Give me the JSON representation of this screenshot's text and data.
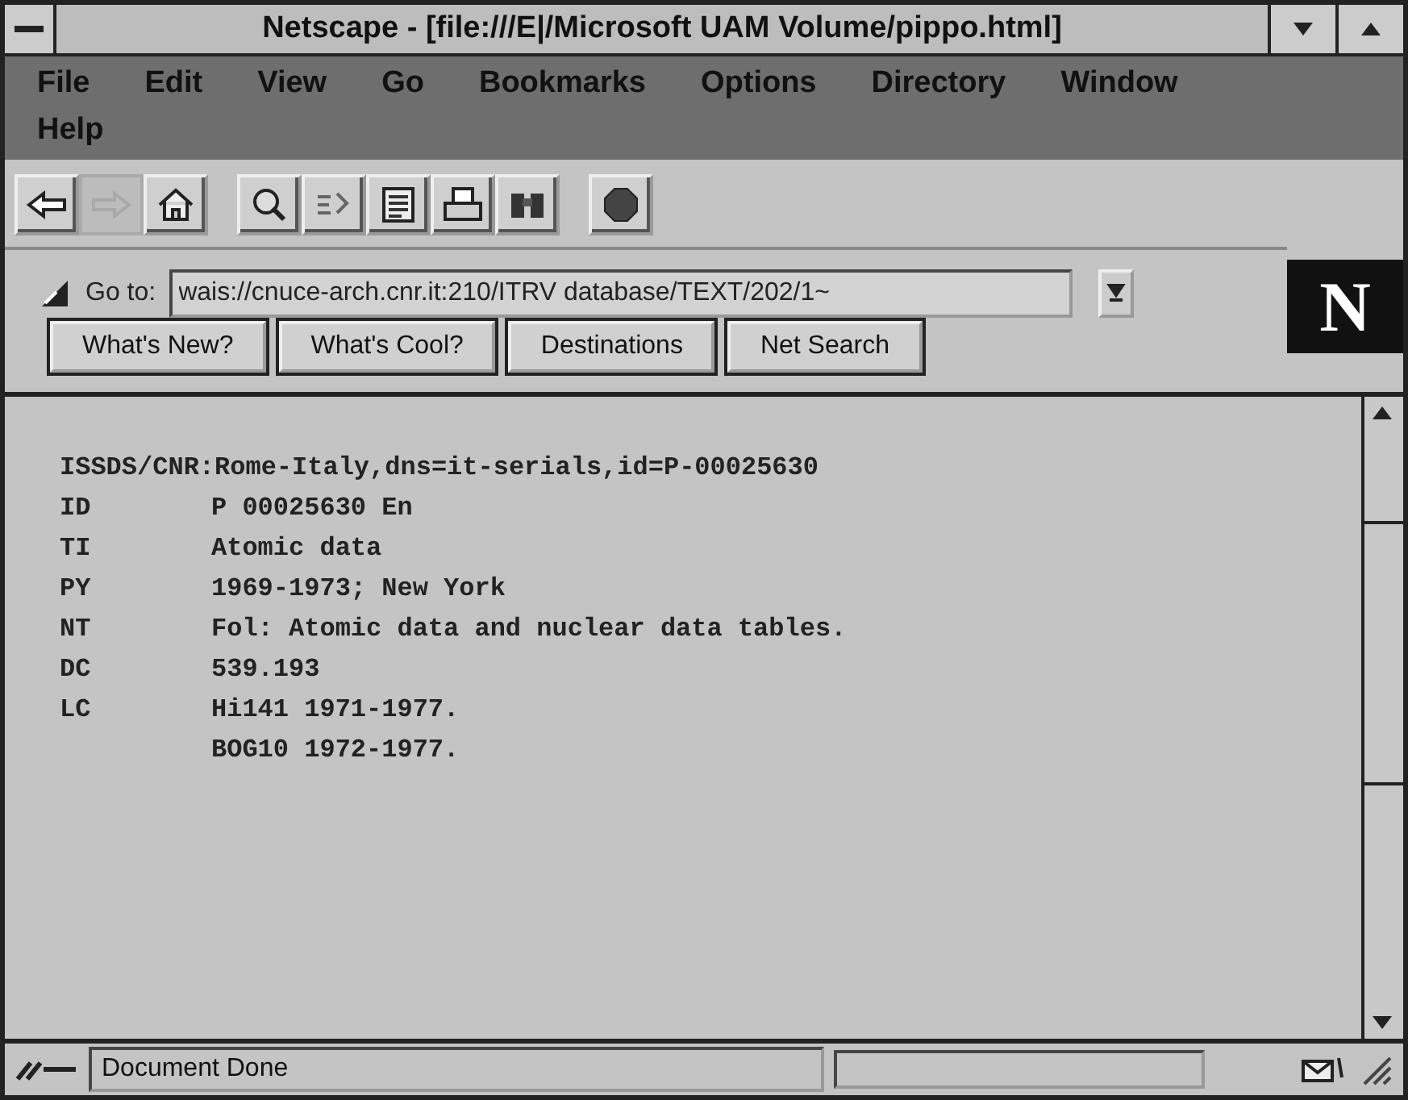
{
  "window": {
    "title": "Netscape - [file:///E|/Microsoft UAM Volume/pippo.html]"
  },
  "menu_bar": [
    "File",
    "Edit",
    "View",
    "Go",
    "Bookmarks",
    "Options",
    "Directory",
    "Window",
    "Help"
  ],
  "toolbar": [
    [
      {
        "kind": "back",
        "disabled": false
      },
      {
        "kind": "forward",
        "disabled": true
      },
      {
        "kind": "home",
        "disabled": false
      }
    ],
    [
      {
        "kind": "images",
        "disabled": false
      },
      {
        "kind": "open",
        "disabled": false
      },
      {
        "kind": "reload",
        "disabled": false
      },
      {
        "kind": "print",
        "disabled": false
      },
      {
        "kind": "find",
        "disabled": false
      }
    ],
    [
      {
        "kind": "stop",
        "disabled": false
      }
    ]
  ],
  "location": {
    "label": "Go to:",
    "value": "wais://cnuce-arch.cnr.it:210/ITRV database/TEXT/202/1~"
  },
  "logo": "N",
  "directory_buttons": [
    "What's New?",
    "What's Cool?",
    "Destinations",
    "Net Search"
  ],
  "content": {
    "header": "ISSDS/CNR:Rome-Italy,dns=it-serials,id=P-00025630",
    "fields": [
      {
        "tag": "ID",
        "value": "P 00025630 En"
      },
      {
        "tag": "TI",
        "value": "Atomic data"
      },
      {
        "tag": "PY",
        "value": "1969-1973; New York"
      },
      {
        "tag": "NT",
        "value": "Fol: Atomic data and nuclear data tables."
      },
      {
        "tag": "DC",
        "value": "539.193"
      },
      {
        "tag": "LC",
        "value": "Hi141 1971-1977."
      },
      {
        "value": "BOG10 1972-1977."
      }
    ]
  },
  "status_bar": {
    "message": "Document Done"
  }
}
